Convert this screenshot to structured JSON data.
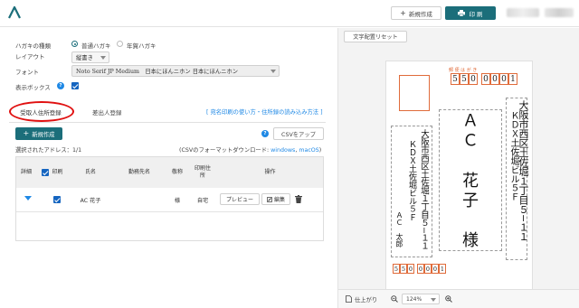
{
  "header": {
    "new_label": "新規作成",
    "print_label": "印 刷"
  },
  "form": {
    "postcard_type_label": "ハガキの種類",
    "postcard_options": [
      "普通ハガキ",
      "年賀ハガキ"
    ],
    "layout_label": "レイアウト",
    "layout_value": "縦書き",
    "font_label": "フォント",
    "font_value": "Noto Serif JP Medium　日本にほんニホン 日本にほんニホン",
    "display_box_label": "表示ボックス"
  },
  "tabs": {
    "recipient": "受取人住所登録",
    "sender": "差出人登録"
  },
  "help_link": "[ 宛名印刷の使い方・住所録の読み込み方法 ]",
  "buttons": {
    "create": "新規作成",
    "csv_upload": "CSVをアップ"
  },
  "selected_count": "選択されたアドレス：1/1",
  "csv_format": {
    "prefix": "(CSVのフォーマットダウンロード: ",
    "windows": "windows",
    "sep": ", ",
    "mac": "macOS",
    "suffix": ")"
  },
  "table": {
    "headers": {
      "detail": "詳細",
      "print": "印刷",
      "name": "氏名",
      "company": "勤務先名",
      "title": "敬称",
      "print_address": "印刷住所",
      "action": "操作"
    },
    "row": {
      "name": "AC 花子",
      "title": "様",
      "print_address": "自宅",
      "preview": "プレビュー",
      "edit": "編集"
    }
  },
  "preview": {
    "reset_label": "文字配置リセット",
    "stamp_label": "郵 便 は が き",
    "zip_digits": [
      "5",
      "5",
      "0",
      "0",
      "0",
      "0",
      "1"
    ],
    "recipient_address_1": "大阪市西区土佐堀１丁目５−１１",
    "recipient_address_2": "ＫＤＸ土佐堀ビル５Ｆ",
    "recipient_name": "ＡＣ　花子　様",
    "sender_address_1": "大阪市西区土佐堀１丁目５−１１",
    "sender_address_2": "ＫＤＸ土佐堀ビル５Ｆ",
    "sender_name": "ＡＣ　太郎",
    "sender_zip_digits": [
      "5",
      "5",
      "0",
      "0",
      "0",
      "0",
      "1"
    ],
    "finish_label": "仕上がり",
    "zoom_value": "124%"
  },
  "colors": {
    "accent": "#1b6e7a",
    "link": "#1e88e5",
    "highlight": "#e01010",
    "postal_frame": "#e06b3a"
  }
}
